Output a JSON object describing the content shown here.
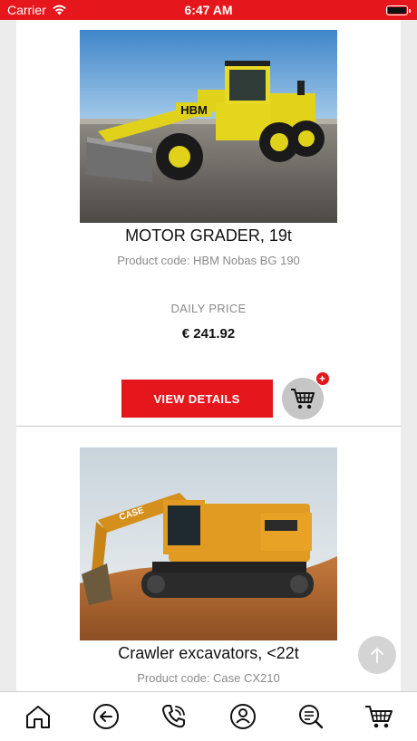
{
  "status_bar": {
    "carrier": "Carrier",
    "time": "6:47 AM",
    "background_color": "#e5161c"
  },
  "products": [
    {
      "title": "MOTOR GRADER, 19t",
      "code": "Product code: HBM Nobas BG 190",
      "price_label": "DAILY PRICE",
      "price": "€ 241.92",
      "view_label": "VIEW DETAILS",
      "cart_badge": "+",
      "image_name": "motor-grader-photo",
      "machine_brand": "HBM"
    },
    {
      "title": "Crawler excavators, <22t",
      "code": "Product code: Case CX210",
      "image_name": "crawler-excavator-photo",
      "machine_brand": "CASE"
    }
  ],
  "bottom_nav": [
    {
      "icon": "home-icon"
    },
    {
      "icon": "back-icon"
    },
    {
      "icon": "phone-icon"
    },
    {
      "icon": "account-icon"
    },
    {
      "icon": "search-icon"
    },
    {
      "icon": "cart-icon"
    }
  ],
  "colors": {
    "accent": "#e5161c",
    "muted_text": "#8a8a8a",
    "cart_button": "#c6c6c6"
  }
}
